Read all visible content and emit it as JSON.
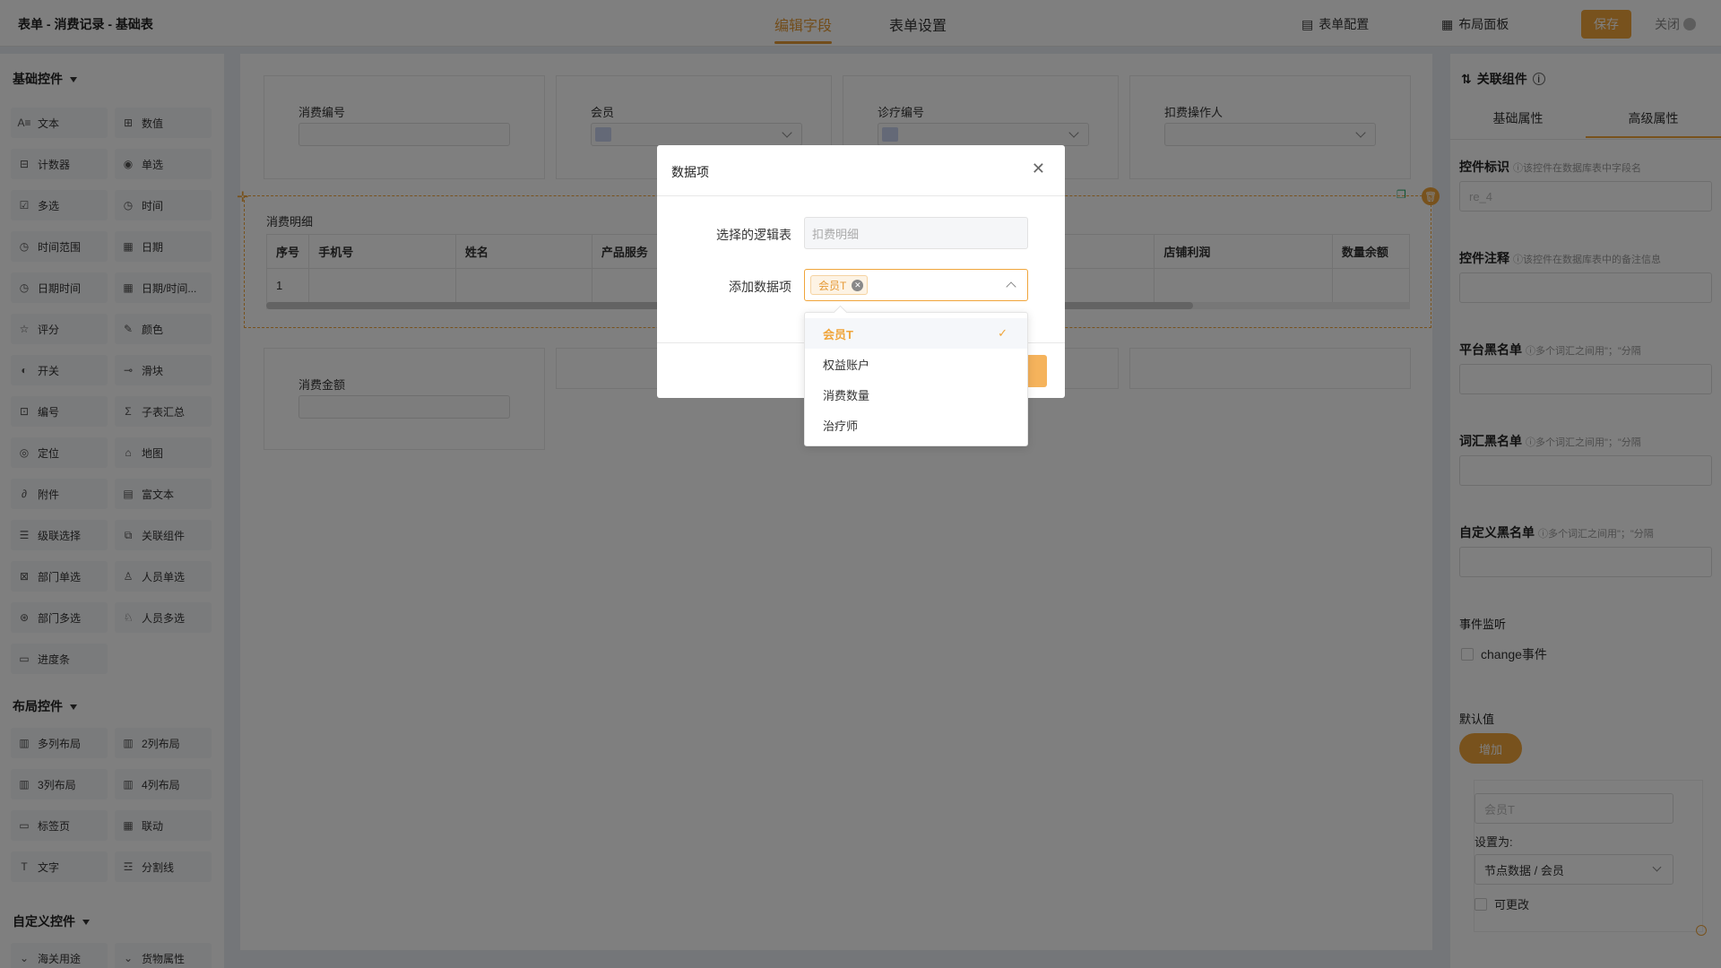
{
  "header": {
    "breadcrumb": "表单 - 消费记录 - 基础表",
    "tabs": [
      {
        "label": "编辑字段",
        "active": true
      },
      {
        "label": "表单设置",
        "active": false
      }
    ],
    "form_config": "表单配置",
    "layout_panel": "布局面板",
    "save": "保存",
    "close": "关闭"
  },
  "left": {
    "basic_title": "基础控件",
    "basic_items": [
      {
        "label": "文本",
        "icon": "text-icon"
      },
      {
        "label": "数值",
        "icon": "number-icon"
      },
      {
        "label": "计数器",
        "icon": "counter-icon"
      },
      {
        "label": "单选",
        "icon": "radio-icon"
      },
      {
        "label": "多选",
        "icon": "checkbox-icon"
      },
      {
        "label": "时间",
        "icon": "clock-icon"
      },
      {
        "label": "时间范围",
        "icon": "clock-icon"
      },
      {
        "label": "日期",
        "icon": "calendar-icon"
      },
      {
        "label": "日期时间",
        "icon": "clock-icon"
      },
      {
        "label": "日期/时间...",
        "icon": "calendar-icon"
      },
      {
        "label": "评分",
        "icon": "star-icon"
      },
      {
        "label": "颜色",
        "icon": "dropper-icon"
      },
      {
        "label": "开关",
        "icon": "toggle-icon"
      },
      {
        "label": "滑块",
        "icon": "slider-icon"
      },
      {
        "label": "编号",
        "icon": "number-tag-icon"
      },
      {
        "label": "子表汇总",
        "icon": "sigma-icon"
      },
      {
        "label": "定位",
        "icon": "location-icon"
      },
      {
        "label": "地图",
        "icon": "map-icon"
      },
      {
        "label": "附件",
        "icon": "paperclip-icon"
      },
      {
        "label": "富文本",
        "icon": "richtext-icon"
      },
      {
        "label": "级联选择",
        "icon": "cascade-icon"
      },
      {
        "label": "关联组件",
        "icon": "link-icon"
      },
      {
        "label": "部门单选",
        "icon": "department-icon"
      },
      {
        "label": "人员单选",
        "icon": "user-icon"
      },
      {
        "label": "部门多选",
        "icon": "departments-icon"
      },
      {
        "label": "人员多选",
        "icon": "users-icon"
      },
      {
        "label": "进度条",
        "icon": "progress-icon"
      }
    ],
    "layout_title": "布局控件",
    "layout_items": [
      {
        "label": "多列布局",
        "icon": "columns-icon"
      },
      {
        "label": "2列布局",
        "icon": "columns-icon"
      },
      {
        "label": "3列布局",
        "icon": "columns-icon"
      },
      {
        "label": "4列布局",
        "icon": "columns-icon"
      },
      {
        "label": "标签页",
        "icon": "tabs-icon"
      },
      {
        "label": "联动",
        "icon": "grid-icon"
      },
      {
        "label": "文字",
        "icon": "type-icon"
      },
      {
        "label": "分割线",
        "icon": "divider-icon"
      }
    ],
    "custom_title": "自定义控件",
    "custom_items": [
      {
        "label": "海关用途",
        "icon": "chevron-icon"
      },
      {
        "label": "货物属性",
        "icon": "chevron-icon"
      }
    ]
  },
  "canvas": {
    "fields_top": [
      {
        "label": "消费编号",
        "type": "input"
      },
      {
        "label": "会员",
        "type": "select"
      },
      {
        "label": "诊疗编号",
        "type": "select"
      },
      {
        "label": "扣费操作人",
        "type": "select"
      }
    ],
    "subtable_title": "消费明细",
    "subtable_columns": [
      "序号",
      "手机号",
      "姓名",
      "产品服务",
      "",
      "",
      "店铺利润",
      "数量余额"
    ],
    "subtable_rows": [
      [
        "1",
        "",
        "",
        "",
        "",
        "",
        "",
        ""
      ]
    ],
    "scroll_fraction": 0.81,
    "fields_bottom": [
      {
        "label": "消费金额",
        "type": "input"
      }
    ]
  },
  "right": {
    "title": "关联组件",
    "tabs": [
      "基础属性",
      "高级属性"
    ],
    "active_tab": "高级属性",
    "fields": [
      {
        "label": "控件标识",
        "hint": "该控件在数据库表中字段名",
        "value": "re_4"
      },
      {
        "label": "控件注释",
        "hint": "该控件在数据库表中的备注信息",
        "value": ""
      },
      {
        "label": "平台黑名单",
        "hint": "多个词汇之间用\"；\"分隔",
        "value": ""
      },
      {
        "label": "词汇黑名单",
        "hint": "多个词汇之间用\"；\"分隔",
        "value": ""
      },
      {
        "label": "自定义黑名单",
        "hint": "多个词汇之间用\"；\"分隔",
        "value": ""
      }
    ],
    "event_title": "事件监听",
    "event_option": "change事件",
    "default_title": "默认值",
    "add_button": "增加",
    "default_card": {
      "field": "会员T",
      "set_as_label": "设置为:",
      "set_as_value": "节点数据 / 会员",
      "editable_label": "可更改"
    }
  },
  "modal": {
    "title": "数据项",
    "logic_table_label": "选择的逻辑表",
    "logic_table_placeholder": "扣费明细",
    "add_item_label": "添加数据项",
    "selected_tag": "会员T",
    "options": [
      {
        "label": "会员T",
        "selected": true
      },
      {
        "label": "权益账户",
        "selected": false
      },
      {
        "label": "消费数量",
        "selected": false
      },
      {
        "label": "治疗师",
        "selected": false
      }
    ]
  },
  "colors": {
    "accent": "#f0a53b",
    "overlay": "rgba(0,0,0,0.5)"
  }
}
